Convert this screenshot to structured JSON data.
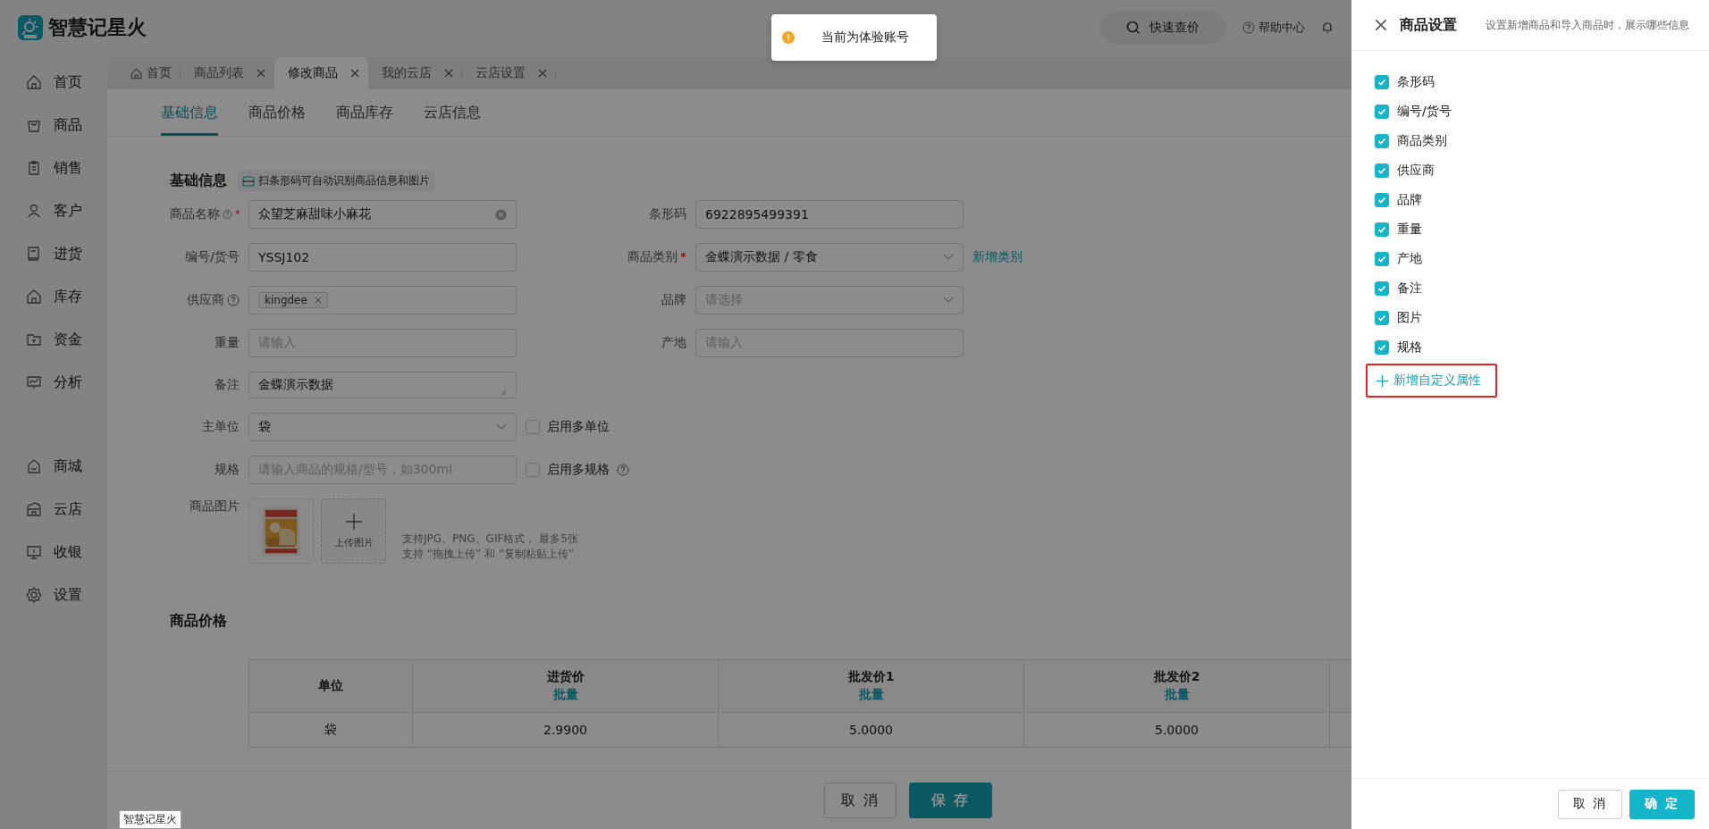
{
  "app": {
    "logo_text": "智慧记星火"
  },
  "header": {
    "quick_price": "快速查价",
    "help": "帮助中心"
  },
  "toast": {
    "message": "当前为体验账号"
  },
  "sidebar": {
    "items": [
      {
        "label": "首页",
        "selected": false
      },
      {
        "label": "商品",
        "selected": false
      },
      {
        "label": "销售",
        "selected": false
      },
      {
        "label": "客户",
        "selected": false
      },
      {
        "label": "进货",
        "selected": false
      },
      {
        "label": "库存",
        "selected": false
      },
      {
        "label": "资金",
        "selected": false
      },
      {
        "label": "分析",
        "selected": false
      }
    ],
    "bottom_items": [
      {
        "label": "商城",
        "selected": false
      },
      {
        "label": "云店",
        "selected": false
      },
      {
        "label": "收银",
        "selected": false
      },
      {
        "label": "设置",
        "selected": false
      }
    ]
  },
  "tabs": [
    {
      "label": "首页",
      "closable": false,
      "selected": false
    },
    {
      "label": "商品列表",
      "closable": true,
      "selected": false
    },
    {
      "label": "修改商品",
      "closable": true,
      "selected": true
    },
    {
      "label": "我的云店",
      "closable": true,
      "selected": false
    },
    {
      "label": "云店设置",
      "closable": true,
      "selected": false
    }
  ],
  "subtabs": [
    {
      "label": "基础信息",
      "selected": true
    },
    {
      "label": "商品价格",
      "selected": false
    },
    {
      "label": "商品库存",
      "selected": false
    },
    {
      "label": "云店信息",
      "selected": false
    }
  ],
  "form": {
    "title": "基础信息",
    "scan_hint": "扫条形码可自动识别商品信息和图片",
    "rows": [
      {
        "left": {
          "label": "商品名称",
          "help": true,
          "required": true,
          "kind": "input",
          "value": "众望芝麻甜味小麻花",
          "clearable": true
        },
        "right": {
          "label": "条形码",
          "kind": "input",
          "value": "6922895499391"
        }
      },
      {
        "left": {
          "label": "编号/货号",
          "kind": "input",
          "value": "YSSJ102"
        },
        "right": {
          "label": "商品类别",
          "required": true,
          "kind": "select",
          "value": "金蝶演示数据 / 零食",
          "link": "新增类别"
        }
      },
      {
        "left": {
          "label": "供应商",
          "help": true,
          "kind": "tags",
          "tags": [
            "kingdee"
          ]
        },
        "right": {
          "label": "品牌",
          "kind": "select",
          "placeholder": "请选择"
        }
      },
      {
        "left": {
          "label": "重量",
          "kind": "input",
          "placeholder": "请输入"
        },
        "right": {
          "label": "产地",
          "kind": "input",
          "placeholder": "请输入"
        }
      },
      {
        "left": {
          "label": "备注",
          "kind": "textarea",
          "value": "金蝶演示数据"
        }
      },
      {
        "left": {
          "label": "主单位",
          "kind": "select",
          "value": "袋"
        },
        "checkbox": {
          "label": "启用多单位",
          "checked": false,
          "help": false
        }
      },
      {
        "left": {
          "label": "规格",
          "kind": "input",
          "placeholder": "请输入商品的规格/型号，如300ml"
        },
        "checkbox": {
          "label": "启用多规格",
          "checked": false,
          "help": true
        }
      },
      {
        "left": {
          "label": "商品图片",
          "kind": "images",
          "upload_label": "上传图片",
          "hint_lines": [
            "支持JPG、PNG、GIF格式， 最多5张",
            "支持 “拖拽上传” 和 “复制粘贴上传”"
          ]
        }
      }
    ]
  },
  "prices": {
    "title": "商品价格",
    "columns": [
      {
        "title": "单位"
      },
      {
        "title": "进货价",
        "sub": "批量"
      },
      {
        "title": "批发价1",
        "sub": "批量"
      },
      {
        "title": "批发价2",
        "sub": "批量"
      }
    ],
    "rows": [
      [
        "袋",
        "2.9900",
        "5.0000",
        "5.0000"
      ]
    ]
  },
  "footer": {
    "buttons": [
      {
        "label": "取 消",
        "kind": "default"
      },
      {
        "label": "保 存",
        "kind": "primary"
      }
    ]
  },
  "tooltip": {
    "text": "智慧记星火"
  },
  "drawer": {
    "title": "商品设置",
    "subtitle": "设置新增商品和导入商品时，展示哪些信息",
    "options": [
      {
        "label": "条形码",
        "checked": true
      },
      {
        "label": "编号/货号",
        "checked": true
      },
      {
        "label": "商品类别",
        "checked": true
      },
      {
        "label": "供应商",
        "checked": true
      },
      {
        "label": "品牌",
        "checked": true
      },
      {
        "label": "重量",
        "checked": true
      },
      {
        "label": "产地",
        "checked": true
      },
      {
        "label": "备注",
        "checked": true
      },
      {
        "label": "图片",
        "checked": true
      },
      {
        "label": "规格",
        "checked": true
      }
    ],
    "add_button": {
      "label": "新增自定义属性",
      "highlighted": true
    },
    "buttons": [
      {
        "label": "取 消",
        "kind": "default"
      },
      {
        "label": "确 定",
        "kind": "primary"
      }
    ]
  }
}
